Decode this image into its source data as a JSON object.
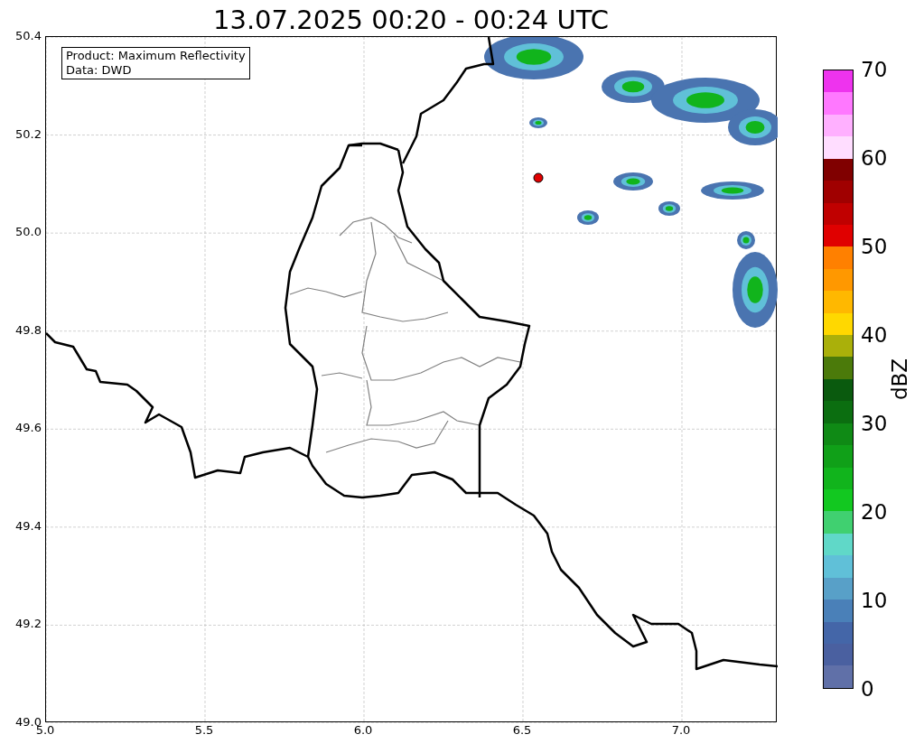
{
  "title": "13.07.2025 00:20 - 00:24 UTC",
  "map": {
    "yticks": [
      "50.4",
      "50.2",
      "50.0",
      "49.8",
      "49.6",
      "49.4",
      "49.2",
      "49.0"
    ],
    "xticks": [
      "5.0",
      "5.5",
      "6.0",
      "6.5",
      "7.0"
    ],
    "info_box": [
      "Product: Maximum Reflectivity",
      "Data: DWD"
    ]
  },
  "colorbar": {
    "label": "dBZ",
    "ticks": [
      "70",
      "60",
      "50",
      "40",
      "30",
      "20",
      "10",
      "0"
    ],
    "bands": [
      {
        "color": "#ee33ee"
      },
      {
        "color": "#ff78ff"
      },
      {
        "color": "#ffb0ff"
      },
      {
        "color": "#ffddff"
      },
      {
        "color": "#800000"
      },
      {
        "color": "#a00000"
      },
      {
        "color": "#c00000"
      },
      {
        "color": "#e00000"
      },
      {
        "color": "#ff8000"
      },
      {
        "color": "#ff9800"
      },
      {
        "color": "#ffb800"
      },
      {
        "color": "#ffd800"
      },
      {
        "color": "#aab00a"
      },
      {
        "color": "#4b7a0a"
      },
      {
        "color": "#0a5a0e"
      },
      {
        "color": "#0b6e10"
      },
      {
        "color": "#0f8a15"
      },
      {
        "color": "#10a018"
      },
      {
        "color": "#11b41c"
      },
      {
        "color": "#12c820"
      },
      {
        "color": "#40d070"
      },
      {
        "color": "#60d8c8"
      },
      {
        "color": "#60c0d8"
      },
      {
        "color": "#58a0c8"
      },
      {
        "color": "#4a80b8"
      },
      {
        "color": "#4466a8"
      },
      {
        "color": "#4a60a0"
      },
      {
        "color": "#6070a8"
      }
    ]
  }
}
